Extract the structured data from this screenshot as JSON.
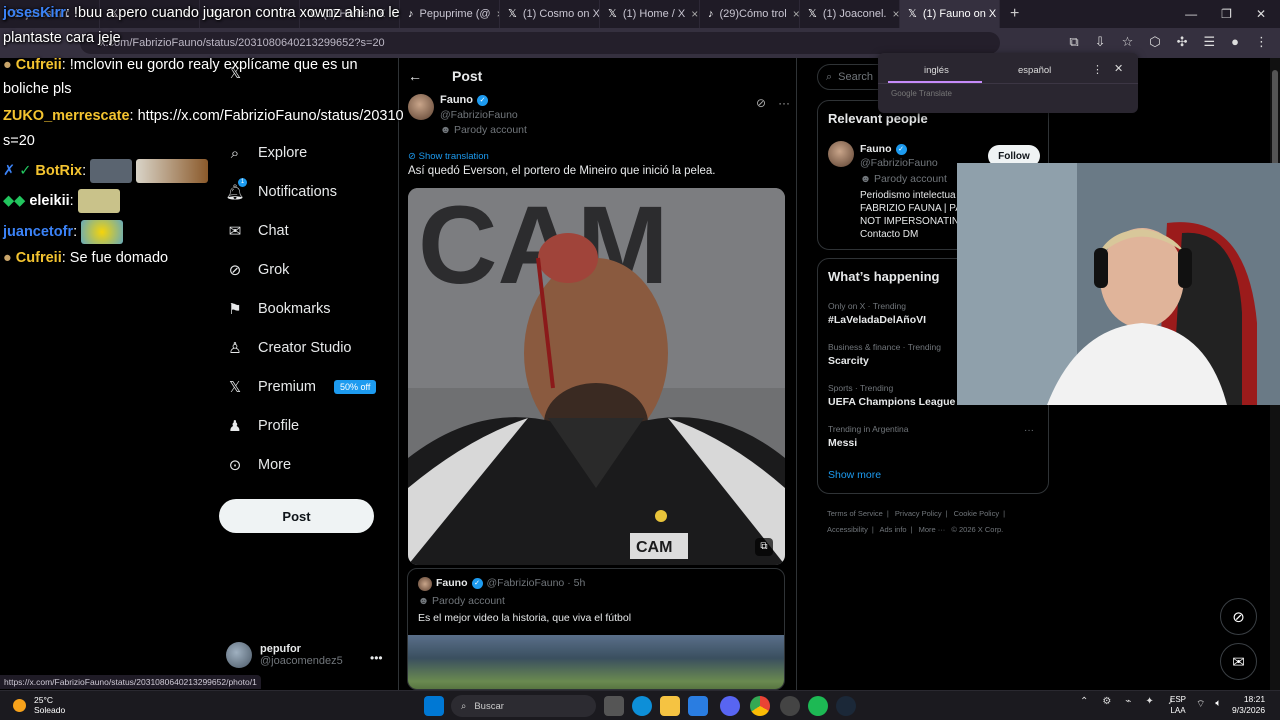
{
  "browser": {
    "tabs": [
      {
        "label": "josesKirr",
        "icon": "x-logo-icon"
      },
      {
        "label": "",
        "icon": "x-logo-icon"
      },
      {
        "label": "",
        "icon": "x-logo-icon"
      },
      {
        "label": "(1) Home / X",
        "icon": "x-logo-icon"
      },
      {
        "label": "Pepuprime (@",
        "icon": "tiktok-icon"
      },
      {
        "label": "(1) Cosmo on X",
        "icon": "x-logo-icon"
      },
      {
        "label": "(1) Home / X",
        "icon": "x-logo-icon"
      },
      {
        "label": "(29)Cómo trol",
        "icon": "tiktok-icon"
      },
      {
        "label": "(1) Joaconel.",
        "icon": "x-logo-icon"
      },
      {
        "label": "(1) Fauno on X",
        "icon": "x-logo-icon"
      }
    ],
    "address": "x.com/FabrizioFauno/status/2031080640213299652?s=20",
    "status_url": "https://x.com/FabrizioFauno/status/2031080640213299652/photo/1"
  },
  "chat": [
    {
      "user": "josesKirr",
      "user_color": "#3b82f6",
      "text": ": !buu a pero cuando jugaron contra xownz ahi no le"
    },
    {
      "user": "",
      "user_color": "#ffffff",
      "text": "plantaste cara jeje"
    },
    {
      "user": "Cufreii",
      "user_color": "#f4c430",
      "text": ": !mclovin eu gordo realy explícame que es un"
    },
    {
      "user": "",
      "user_color": "#ffffff",
      "text": "boliche pls"
    },
    {
      "user": "ZUKO_merrescate",
      "user_color": "#f4c430",
      "text": ": https://x.com/FabrizioFauno/status/20310"
    },
    {
      "user": "",
      "user_color": "#ffffff",
      "text": "s=20"
    },
    {
      "user": "BotRix",
      "user_color": "#f4c430",
      "text": ":"
    },
    {
      "user": "eleikii",
      "user_color": "#ffffff",
      "text": ":"
    },
    {
      "user": "juancetofr",
      "user_color": "#3b82f6",
      "text": ":"
    },
    {
      "user": "Cufreii",
      "user_color": "#f4c430",
      "text": ": Se fue domado"
    }
  ],
  "nav": {
    "items": [
      {
        "label": "Explore",
        "icon": "search-icon"
      },
      {
        "label": "Notifications",
        "icon": "bell-icon",
        "badge": "1"
      },
      {
        "label": "Chat",
        "icon": "mail-icon"
      },
      {
        "label": "Grok",
        "icon": "grok-icon"
      },
      {
        "label": "Bookmarks",
        "icon": "bookmark-icon"
      },
      {
        "label": "Creator Studio",
        "icon": "creator-icon"
      },
      {
        "label": "Premium",
        "icon": "x-logo-icon",
        "badge": "50% off"
      },
      {
        "label": "Profile",
        "icon": "person-icon"
      },
      {
        "label": "More",
        "icon": "more-circle-icon"
      }
    ],
    "post_button": "Post",
    "account": {
      "name": "pepufor",
      "handle": "@joacomendez5"
    }
  },
  "main": {
    "header": "Post",
    "post": {
      "name": "Fauno",
      "handle": "@FabrizioFauno",
      "parody": "Parody account",
      "show_translation": "Show translation",
      "text": "Así quedó Everson, el portero de Mineiro que inició la pelea."
    },
    "quote": {
      "name": "Fauno",
      "handle": "@FabrizioFauno · 5h",
      "parody": "Parody account",
      "text": "Es el mejor video la historia, que viva el fútbol"
    }
  },
  "right": {
    "search_placeholder": "Search",
    "translate": {
      "lang_a": "inglés",
      "lang_b": "español",
      "footer": "Google Translate"
    },
    "relevant": {
      "title": "Relevant people",
      "name": "Fauno",
      "handle": "@FabrizioFauno",
      "parody": "Parody account",
      "bio": [
        "Periodismo intelectua",
        "FABRIZIO FAUNA | PA",
        "NOT IMPERSONATIN",
        "Contacto DM"
      ],
      "follow": "Follow"
    },
    "happening": {
      "title": "What’s happening",
      "trends": [
        {
          "meta": "Only on X · Trending",
          "name": "#LaVeladaDelAñoVI"
        },
        {
          "meta": "Business & finance · Trending",
          "name": "Scarcity"
        },
        {
          "meta": "Sports · Trending",
          "name": "UEFA Champions League"
        },
        {
          "meta": "Trending in Argentina",
          "name": "Messi"
        }
      ],
      "show_more": "Show more"
    },
    "footer": [
      "Terms of Service",
      "|",
      "Privacy Policy",
      "|",
      "Cookie Policy",
      "|",
      "Accessibility",
      "|",
      "Ads info",
      "|",
      "More ···",
      "© 2026 X Corp."
    ]
  },
  "taskbar": {
    "weather_temp": "25°C",
    "weather_desc": "Soleado",
    "search": "Buscar",
    "lang_top": "ESP",
    "lang_bottom": "LAA",
    "time": "18:21",
    "date": "9/3/2026"
  }
}
